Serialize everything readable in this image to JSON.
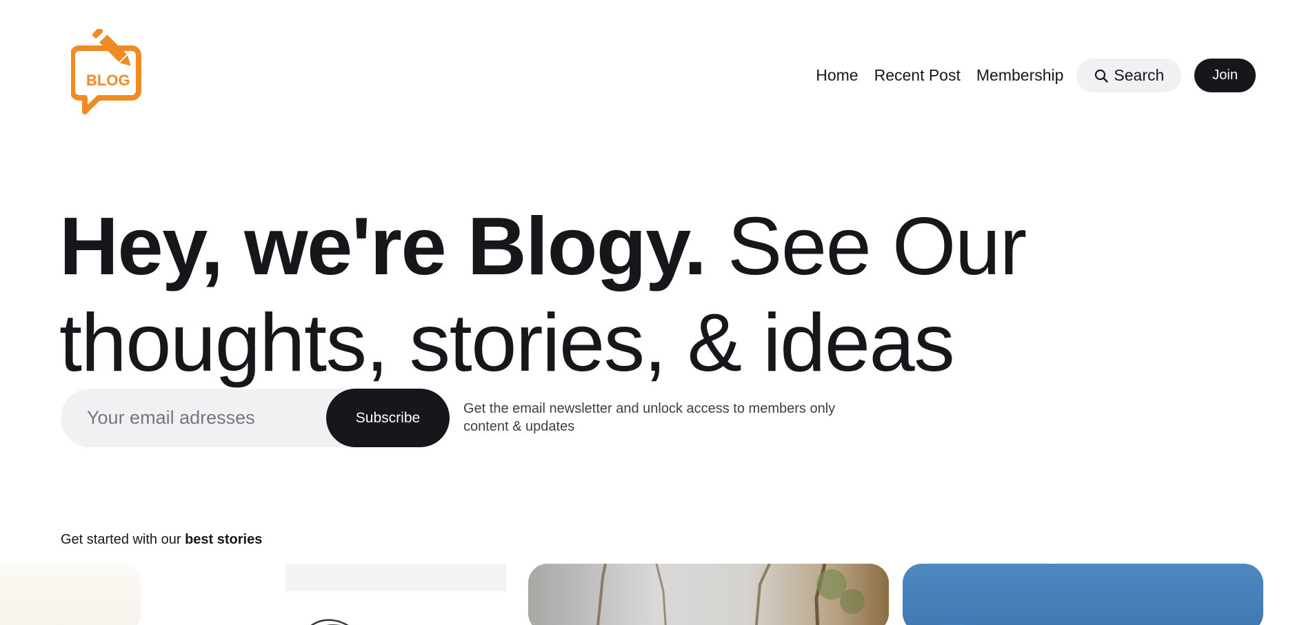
{
  "brand": {
    "logo_text": "BLOG",
    "logo_color": "#f08a24"
  },
  "nav": {
    "items": [
      {
        "label": "Home"
      },
      {
        "label": "Recent Post"
      },
      {
        "label": "Membership"
      }
    ],
    "search_label": "Search",
    "join_label": "Join"
  },
  "hero": {
    "title_bold": "Hey, we're Blogy.",
    "title_regular": " See Our thoughts, stories, & ideas"
  },
  "subscribe": {
    "placeholder": "Your email adresses",
    "button_label": "Subscribe",
    "note": "Get the email newsletter and unlock access to members only content & updates"
  },
  "stories": {
    "label_prefix": "Get started with our ",
    "label_bold": "best stories"
  },
  "colors": {
    "text": "#15171a",
    "pill_bg": "#f1f1f3",
    "accent": "#f08a24"
  }
}
